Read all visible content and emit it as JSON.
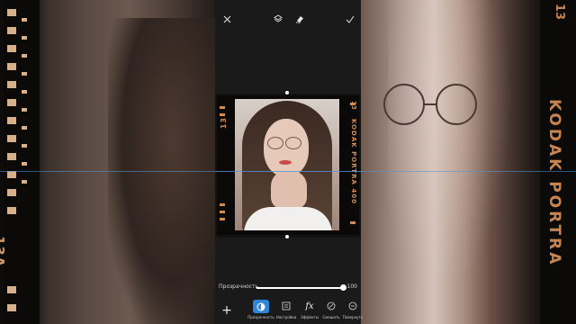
{
  "topbar": {
    "close_icon": "close-icon",
    "layers_icon": "layers-icon",
    "eraser_icon": "eraser-icon",
    "apply_icon": "check-icon"
  },
  "background": {
    "left_film_text": "13A",
    "right_film_number": "13",
    "right_film_text": "KODAK PORTRA"
  },
  "film_frame": {
    "left_text": "13",
    "right_number": "13",
    "right_text": "KODAK PORTRA 400",
    "accent": "#d9894a"
  },
  "opacity": {
    "label": "Прозрачность",
    "value": "100",
    "level_percent": 100
  },
  "toolbar": {
    "add_label": "+",
    "tools": [
      {
        "label": "Прозрачность",
        "icon": "opacity-icon",
        "active": true
      },
      {
        "label": "Настройки",
        "icon": "adjust-icon",
        "active": false
      },
      {
        "label": "Эффекты",
        "icon": "fx-icon",
        "active": false
      },
      {
        "label": "Смешать",
        "icon": "blend-icon",
        "active": false
      },
      {
        "label": "Повернуть",
        "icon": "rotate-icon",
        "active": false
      }
    ]
  },
  "colors": {
    "accent_blue": "#2f86d8",
    "panel_bg": "#1a1a1a"
  }
}
